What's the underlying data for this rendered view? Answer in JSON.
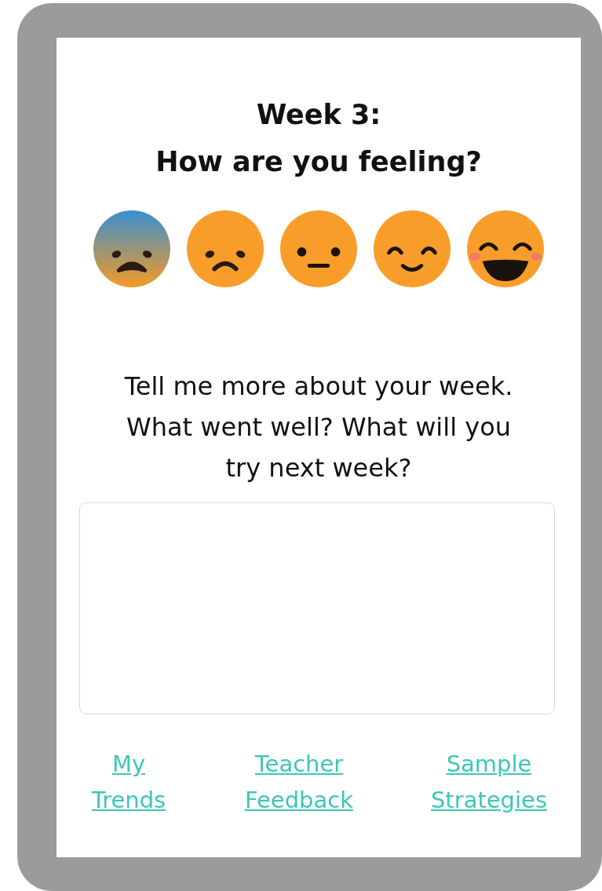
{
  "title": {
    "week": "Week 3:",
    "question": "How are you feeling?"
  },
  "moods": [
    {
      "kind": "fearful"
    },
    {
      "kind": "sad"
    },
    {
      "kind": "neutral"
    },
    {
      "kind": "content"
    },
    {
      "kind": "happy"
    }
  ],
  "prompt": "Tell me more about your week. What went well? What will you try next week?",
  "links": [
    {
      "label": "My Trends"
    },
    {
      "label": "Teacher Feedback"
    },
    {
      "label": "Sample Strategies"
    }
  ]
}
